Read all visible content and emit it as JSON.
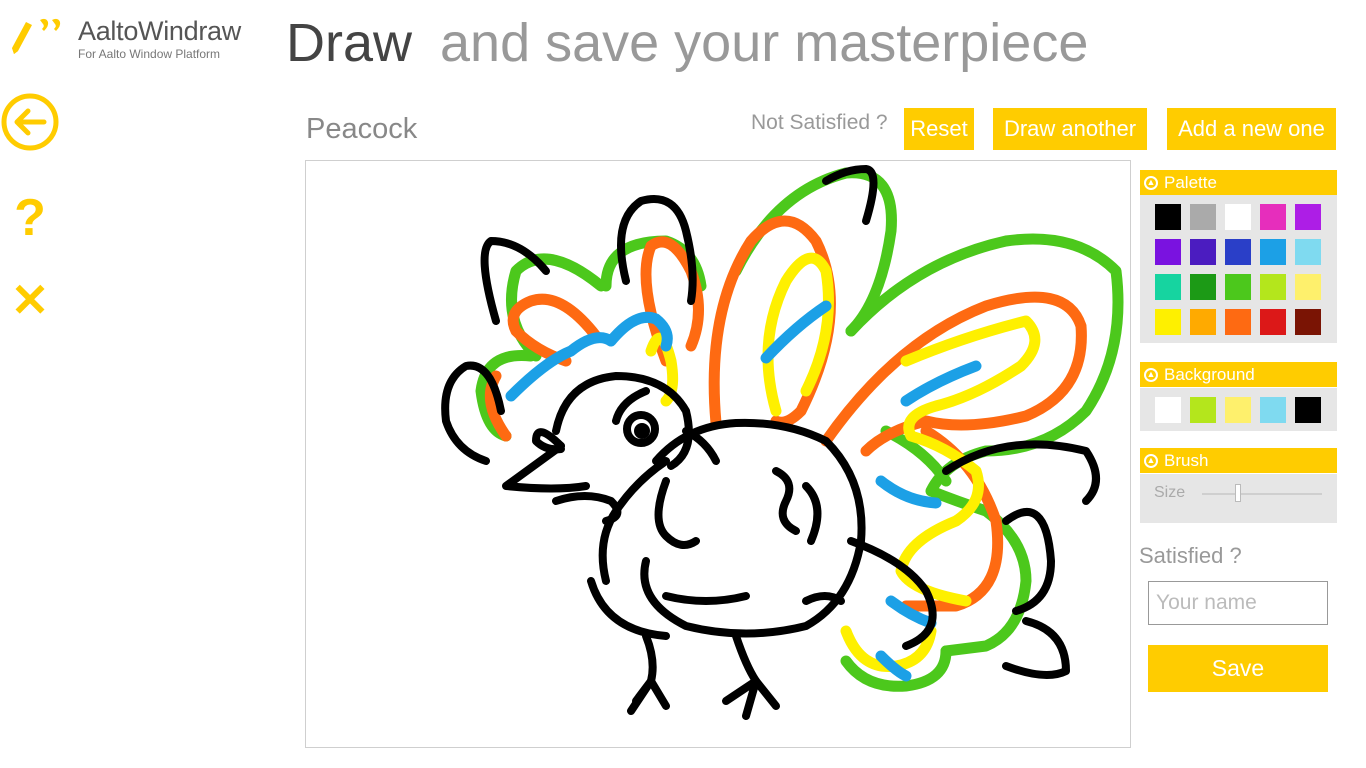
{
  "app": {
    "title": "AaltoWindraw",
    "subtitle": "For Aalto Window Platform"
  },
  "header": {
    "title_main": "Draw",
    "title_sub": "and save your masterpiece"
  },
  "nav": {
    "back_icon": "arrow-left-circle-icon",
    "help_label": "?",
    "close_label": "✕"
  },
  "drawing": {
    "name": "Peacock"
  },
  "toolbar": {
    "not_satisfied": "Not Satisfied ?",
    "reset_label": "Reset",
    "draw_another_label": "Draw another",
    "add_new_label": "Add a new one"
  },
  "palette": {
    "title": "Palette",
    "colors": [
      "#000000",
      "#aaaaaa",
      "#ffffff",
      "#e62ebc",
      "#ad1ee6",
      "#7a12e0",
      "#4b1cc0",
      "#2a3fc8",
      "#1ca0e6",
      "#7fdaf0",
      "#16d4a0",
      "#1c9a16",
      "#4cc81c",
      "#b4e61c",
      "#fef06c",
      "#fef000",
      "#ffaa00",
      "#fe6a12",
      "#dc1818",
      "#7a1404"
    ]
  },
  "background": {
    "title": "Background",
    "colors": [
      "#ffffff",
      "#b4e61c",
      "#fef06c",
      "#7fdaf0",
      "#000000"
    ]
  },
  "brush": {
    "title": "Brush",
    "size_label": "Size",
    "size_value": 0.3
  },
  "save": {
    "satisfied_label": "Satisfied ?",
    "name_placeholder": "Your name",
    "name_value": "",
    "save_label": "Save"
  },
  "colors": {
    "accent": "#ffcc00",
    "stroke_black": "#000000",
    "stroke_green": "#4cc81c",
    "stroke_orange": "#fe6a12",
    "stroke_yellow": "#fef000",
    "stroke_blue": "#1ca0e6"
  }
}
